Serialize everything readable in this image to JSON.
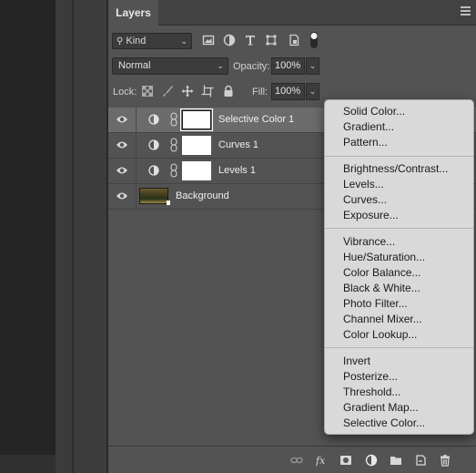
{
  "panel": {
    "tab_label": "Layers",
    "filter": {
      "kind_label": "Kind"
    },
    "blend_mode": "Normal",
    "opacity_label": "Opacity:",
    "opacity_value": "100%",
    "lock_label": "Lock:",
    "fill_label": "Fill:",
    "fill_value": "100%"
  },
  "layers": [
    {
      "name": "Selective Color 1",
      "selected": true,
      "type": "adjustment"
    },
    {
      "name": "Curves 1",
      "selected": false,
      "type": "adjustment"
    },
    {
      "name": "Levels 1",
      "selected": false,
      "type": "adjustment"
    },
    {
      "name": "Background",
      "selected": false,
      "type": "image"
    }
  ],
  "menu": {
    "items": [
      "Solid Color...",
      "Gradient...",
      "Pattern...",
      "Brightness/Contrast...",
      "Levels...",
      "Curves...",
      "Exposure...",
      "Vibrance...",
      "Hue/Saturation...",
      "Color Balance...",
      "Black & White...",
      "Photo Filter...",
      "Channel Mixer...",
      "Color Lookup...",
      "Invert",
      "Posterize...",
      "Threshold...",
      "Gradient Map...",
      "Selective Color..."
    ]
  },
  "colors": {
    "panel_bg": "#535353",
    "selected_row": "#6b6b6b",
    "menu_bg": "#d9d9d9"
  }
}
